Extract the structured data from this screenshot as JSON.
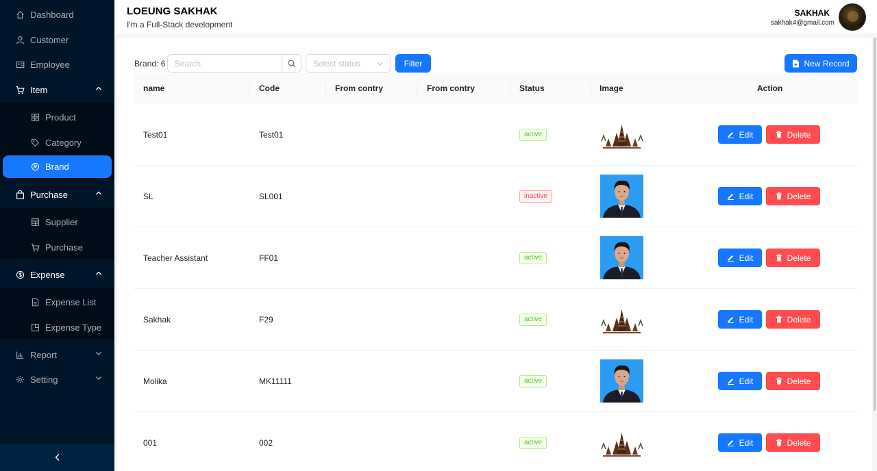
{
  "sidebar": {
    "items": [
      {
        "label": "Dashboard",
        "icon": "home-icon"
      },
      {
        "label": "Customer",
        "icon": "user-icon"
      },
      {
        "label": "Employee",
        "icon": "id-card-icon"
      },
      {
        "label": "Item",
        "icon": "cart-icon",
        "children": [
          {
            "label": "Product",
            "icon": "grid-icon"
          },
          {
            "label": "Category",
            "icon": "tag-icon"
          },
          {
            "label": "Brand",
            "icon": "registered-icon",
            "selected": true
          }
        ]
      },
      {
        "label": "Purchase",
        "icon": "shopping-bag-icon",
        "children": [
          {
            "label": "Supplier",
            "icon": "shop-icon"
          },
          {
            "label": "Purchase",
            "icon": "cart-icon"
          }
        ]
      },
      {
        "label": "Expense",
        "icon": "dollar-icon",
        "children": [
          {
            "label": "Expense List",
            "icon": "file-icon"
          },
          {
            "label": "Expense Type",
            "icon": "file-add-icon"
          }
        ]
      },
      {
        "label": "Report",
        "icon": "bar-chart-icon"
      },
      {
        "label": "Setting",
        "icon": "setting-icon"
      }
    ],
    "collapse_icon": "left-arrow-icon"
  },
  "header": {
    "title": "LOEUNG SAKHAK",
    "subtitle": "I'm a Full-Stack development",
    "user_name": "SAKHAK",
    "user_email": "sakhak4@gmail.com"
  },
  "toolbar": {
    "count_label": "Brand: 6",
    "search_placeholder": "Search",
    "status_placeholder": "Select status",
    "filter_label": "Filter",
    "new_label": "New Record"
  },
  "table": {
    "columns": [
      "name",
      "Code",
      "From contry",
      "From contry",
      "Status",
      "Image",
      "Action"
    ],
    "rows": [
      {
        "name": "Test01",
        "code": "Test01",
        "status": "active",
        "image": "temple"
      },
      {
        "name": "SL",
        "code": "SL001",
        "status": "inactive",
        "image": "portrait"
      },
      {
        "name": "Teacher Assistant",
        "code": "FF01",
        "status": "active",
        "image": "portrait"
      },
      {
        "name": "Sakhak",
        "code": "F29",
        "status": "active",
        "image": "temple"
      },
      {
        "name": "Molika",
        "code": "MK11111",
        "status": "active",
        "image": "portrait"
      },
      {
        "name": "001",
        "code": "002",
        "status": "active",
        "image": "temple"
      }
    ],
    "edit_label": "Edit",
    "delete_label": "Delete"
  },
  "colors": {
    "sidebar_bg": "#001529",
    "submenu_bg": "#000c17",
    "primary": "#1677ff",
    "danger": "#ff4d4f",
    "active_green": "#52c41a"
  }
}
